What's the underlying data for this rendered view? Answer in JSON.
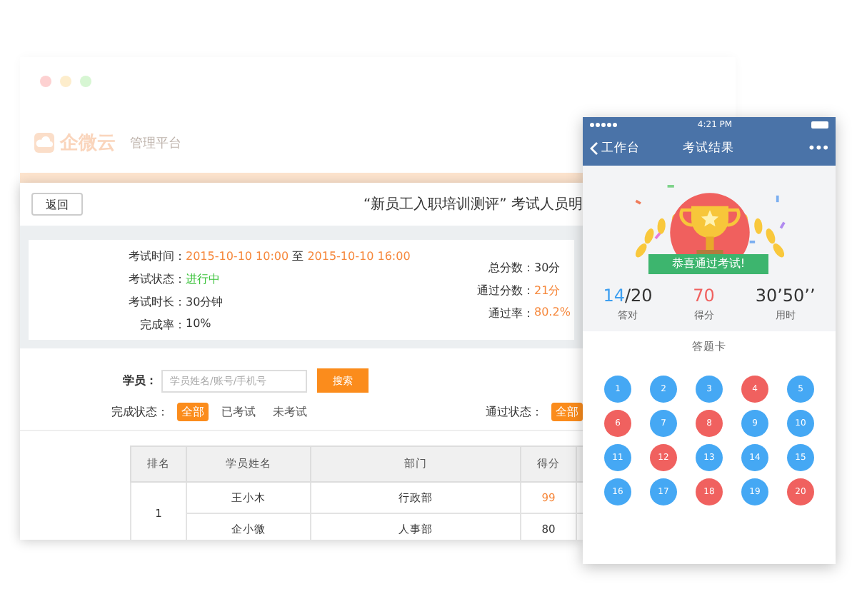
{
  "back_window": {
    "brand": "企微云",
    "subtitle": "管理平台"
  },
  "desktop": {
    "back_button": "返回",
    "title": "“新员工入职培训测评” 考试人员明",
    "info_left": [
      {
        "label": "考试时间：",
        "parts": [
          {
            "text": "2015-10-10 10:00",
            "color": "#f6883c"
          },
          {
            "text": " 至 ",
            "color": "#333333"
          },
          {
            "text": "2015-10-10 16:00",
            "color": "#f6883c"
          }
        ]
      },
      {
        "label": "考试状态：",
        "parts": [
          {
            "text": "进行中",
            "color": "#3cc33c"
          }
        ]
      },
      {
        "label": "考试时长：",
        "parts": [
          {
            "text": "30分钟",
            "color": "#333333"
          }
        ]
      },
      {
        "label": "完成率：",
        "parts": [
          {
            "text": "10%",
            "color": "#333333"
          }
        ]
      }
    ],
    "info_right": [
      {
        "label": "总分数：",
        "parts": [
          {
            "text": "30分",
            "color": "#333333"
          }
        ]
      },
      {
        "label": "通过分数：",
        "parts": [
          {
            "text": "21分",
            "color": "#f6883c"
          }
        ]
      },
      {
        "label": "通过率：",
        "parts": [
          {
            "text": "80.2%",
            "color": "#f6883c"
          }
        ]
      }
    ],
    "search": {
      "label": "学员：",
      "placeholder": "学员姓名/账号/手机号",
      "button": "搜索"
    },
    "completion_filter": {
      "label": "完成状态：",
      "options": [
        {
          "label": "全部",
          "selected": true
        },
        {
          "label": "已考试",
          "selected": false
        },
        {
          "label": "未考试",
          "selected": false
        }
      ]
    },
    "pass_filter": {
      "label": "通过状态：",
      "options": [
        {
          "label": "全部",
          "selected": true
        }
      ]
    },
    "table": {
      "columns": [
        "排名",
        "学员姓名",
        "部门",
        "得分"
      ],
      "groups": [
        {
          "rank": "1",
          "rows": [
            {
              "name": "王小木",
              "dept": "行政部",
              "score": "99",
              "highlight": true
            },
            {
              "name": "企小微",
              "dept": "人事部",
              "score": "80",
              "highlight": false
            }
          ]
        }
      ]
    }
  },
  "phone": {
    "status_bar": {
      "time": "4:21 PM"
    },
    "nav": {
      "back": "工作台",
      "title": "考试结果",
      "more": "•••"
    },
    "banner": "恭喜通过考试!",
    "stats": [
      {
        "value": "14",
        "suffix": "/20",
        "label": "答对",
        "color": "#3e9ff0"
      },
      {
        "value": "70",
        "label": "得分",
        "color": "#f0615f"
      },
      {
        "value": "30’50’’",
        "label": "用时",
        "color": "#333333"
      }
    ],
    "card_title": "答题卡",
    "answers": [
      {
        "number": "1",
        "color": "#45a8f4"
      },
      {
        "number": "2",
        "color": "#45a8f4"
      },
      {
        "number": "3",
        "color": "#45a8f4"
      },
      {
        "number": "4",
        "color": "#f0615f"
      },
      {
        "number": "5",
        "color": "#45a8f4"
      },
      {
        "number": "6",
        "color": "#f0615f"
      },
      {
        "number": "7",
        "color": "#45a8f4"
      },
      {
        "number": "8",
        "color": "#f0615f"
      },
      {
        "number": "9",
        "color": "#45a8f4"
      },
      {
        "number": "10",
        "color": "#45a8f4"
      },
      {
        "number": "11",
        "color": "#45a8f4"
      },
      {
        "number": "12",
        "color": "#f0615f"
      },
      {
        "number": "13",
        "color": "#45a8f4"
      },
      {
        "number": "14",
        "color": "#45a8f4"
      },
      {
        "number": "15",
        "color": "#45a8f4"
      },
      {
        "number": "16",
        "color": "#45a8f4"
      },
      {
        "number": "17",
        "color": "#45a8f4"
      },
      {
        "number": "18",
        "color": "#f0615f"
      },
      {
        "number": "19",
        "color": "#45a8f4"
      },
      {
        "number": "20",
        "color": "#f0615f"
      }
    ]
  }
}
